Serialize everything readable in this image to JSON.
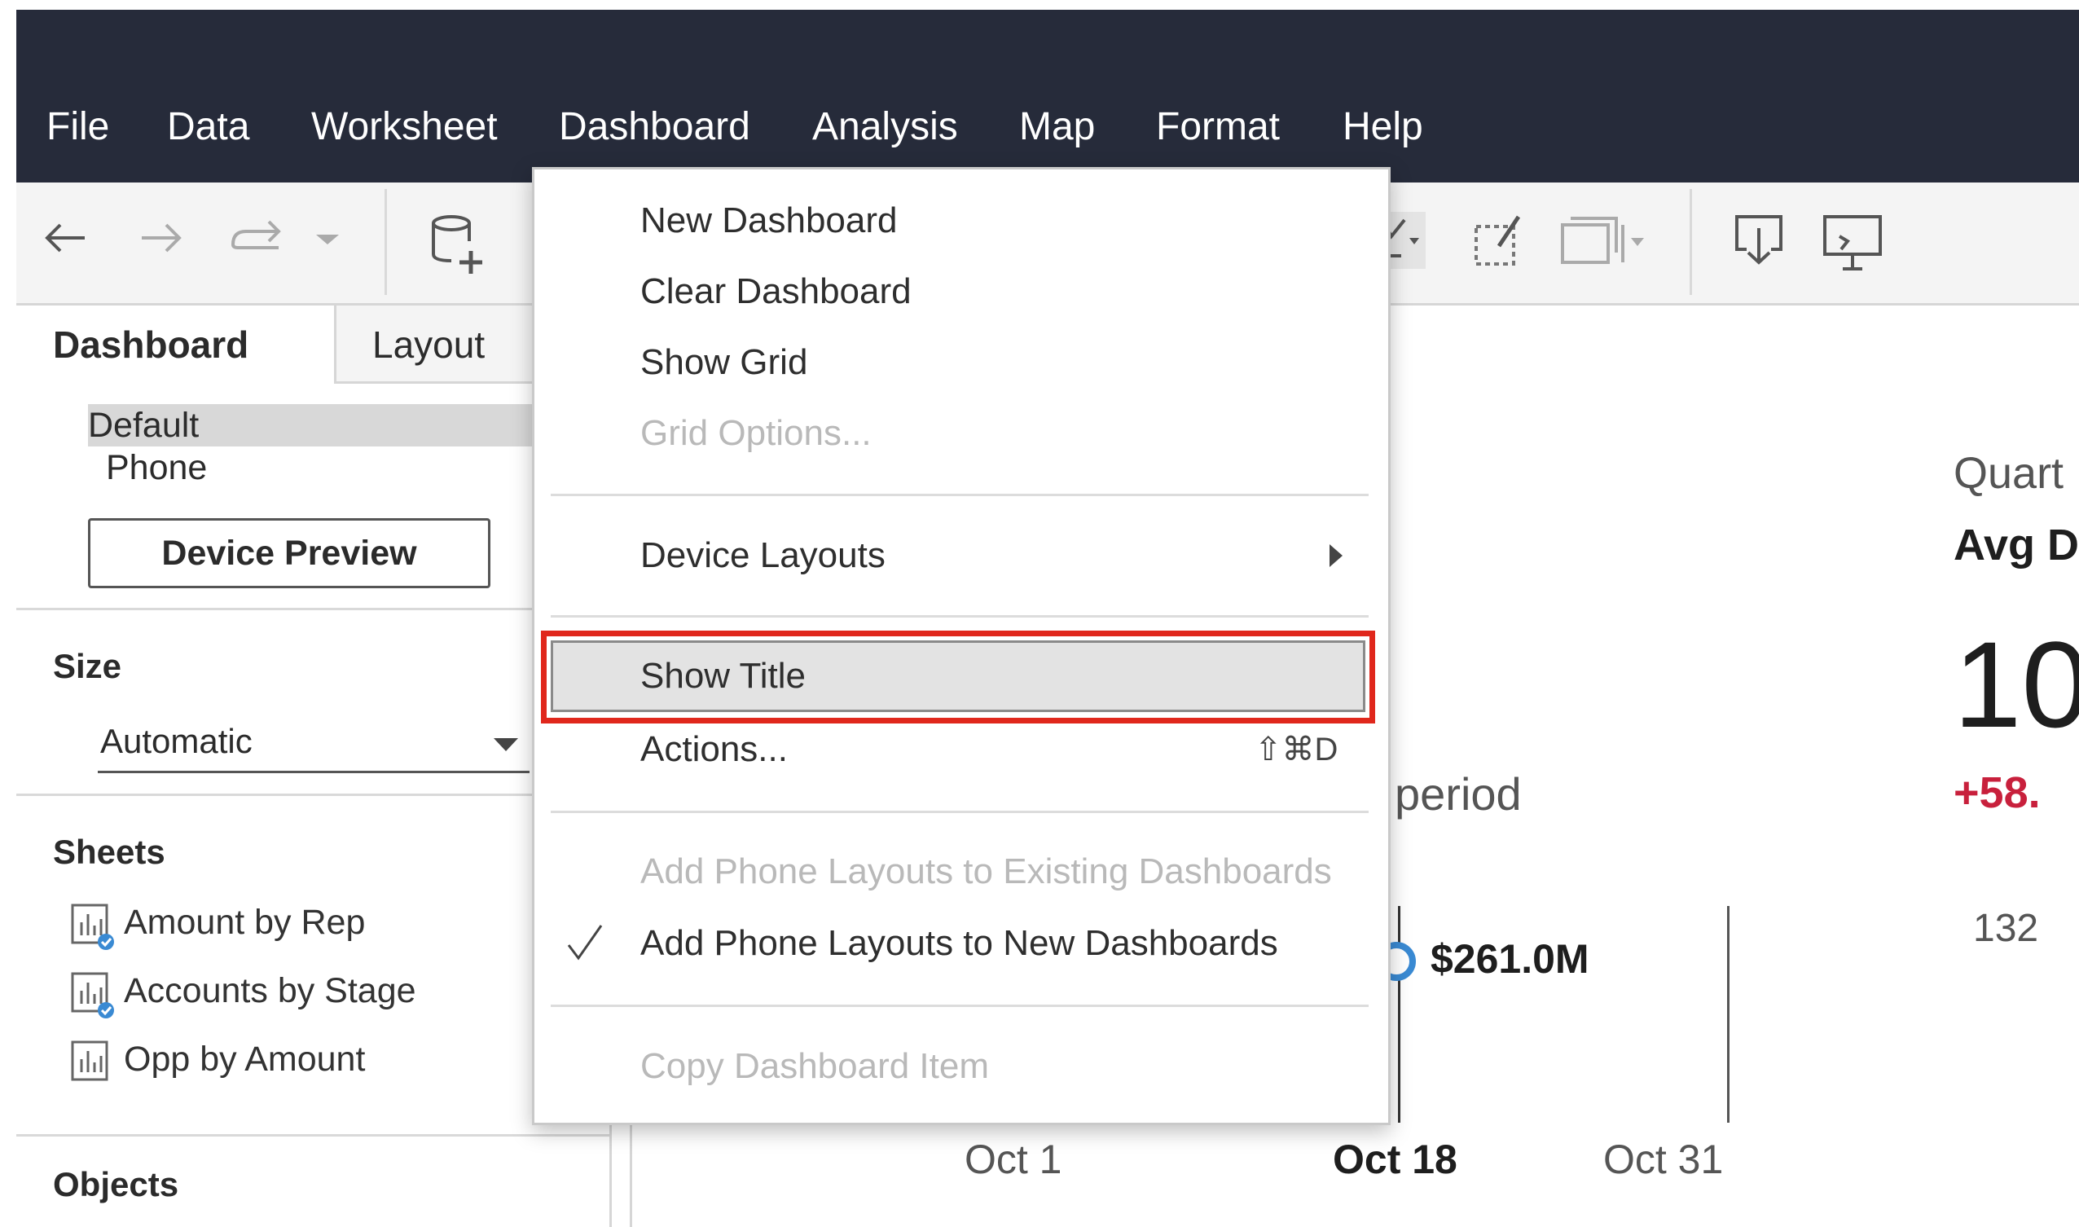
{
  "menubar": {
    "items": [
      "File",
      "Data",
      "Worksheet",
      "Dashboard",
      "Analysis",
      "Map",
      "Format",
      "Help"
    ]
  },
  "left_panel": {
    "tabs": {
      "dashboard": "Dashboard",
      "layout": "Layout"
    },
    "device_list": {
      "default": "Default",
      "phone": "Phone"
    },
    "device_preview_button": "Device Preview",
    "size": {
      "title": "Size",
      "value": "Automatic"
    },
    "sheets": {
      "title": "Sheets",
      "items": [
        "Amount by Rep",
        "Accounts by Stage",
        "Opp by Amount"
      ]
    },
    "objects": {
      "title": "Objects"
    }
  },
  "dashboard_menu": {
    "items": {
      "new_dashboard": "New Dashboard",
      "clear_dashboard": "Clear Dashboard",
      "show_grid": "Show Grid",
      "grid_options": "Grid Options...",
      "device_layouts": "Device Layouts",
      "show_title": "Show Title",
      "actions": "Actions...",
      "actions_shortcut": "⇧⌘D",
      "add_phone_existing": "Add Phone Layouts to Existing Dashboards",
      "add_phone_new": "Add Phone Layouts to New Dashboards",
      "copy_item": "Copy Dashboard Item"
    },
    "highlight_color": "#e0271c"
  },
  "canvas": {
    "period_text": "period",
    "value_label": "$261.0M",
    "dates": [
      "Oct 1",
      "Oct 18",
      "Oct 31"
    ],
    "right_panel": {
      "quart": "Quart",
      "avg": "Avg D",
      "big_number": "10",
      "change": "+58.",
      "count": "132"
    },
    "change_color": "#c8203c"
  }
}
